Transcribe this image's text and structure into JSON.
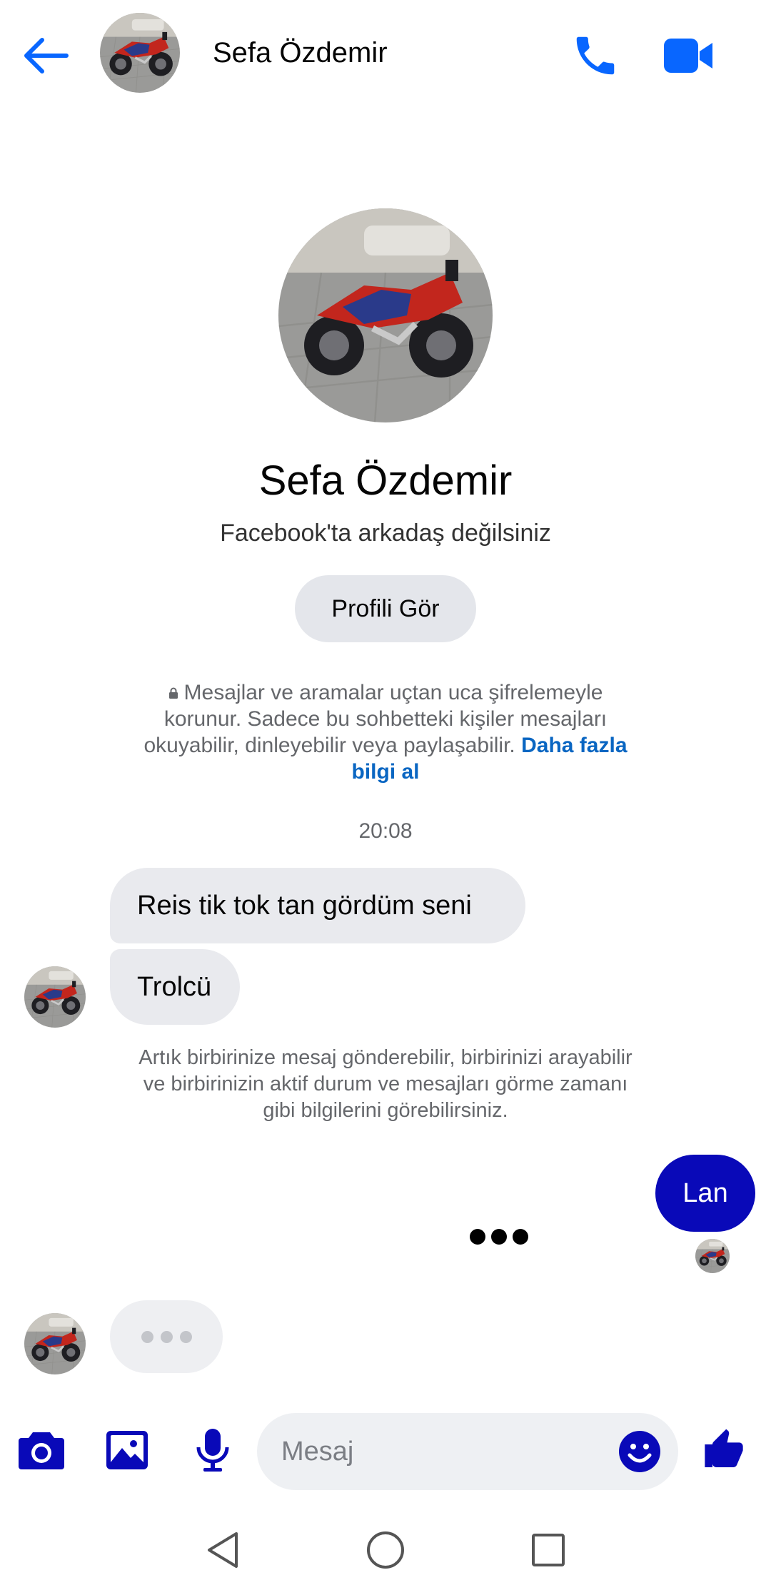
{
  "header": {
    "contact_name": "Sefa Özdemir",
    "back_icon": "arrow-left-icon",
    "call_icon": "phone-icon",
    "video_icon": "video-camera-icon",
    "accent_color": "#0866ff"
  },
  "profile": {
    "name": "Sefa Özdemir",
    "relationship": "Facebook'ta arkadaş değilsiniz",
    "view_profile_label": "Profili Gör"
  },
  "encryption_note": {
    "text": "Mesajlar ve aramalar uçtan uca şifrelemeyle korunur. Sadece bu sohbetteki kişiler mesajları okuyabilir, dinleyebilir veya paylaşabilir.",
    "link": "Daha fazla bilgi al"
  },
  "thread": {
    "timestamp": "20:08",
    "incoming": [
      "Reis tik tok tan gördüm seni",
      "Trolcü"
    ],
    "connection_note": "Artık birbirinize mesaj gönderebilir, birbirinizi arayabilir ve birbirinizin aktif durum ve mesajları görme zamanı gibi bilgilerini görebilirsiniz.",
    "outgoing": [
      "Lan"
    ],
    "outgoing_color": "#0909b8"
  },
  "composer": {
    "placeholder": "Mesaj",
    "camera_icon": "camera-icon",
    "gallery_icon": "image-icon",
    "mic_icon": "microphone-icon",
    "emoji_icon": "smiley-icon",
    "like_icon": "thumbs-up-icon",
    "icon_color": "#0909b8"
  },
  "system_nav": {
    "back_icon": "triangle-back-icon",
    "home_icon": "circle-home-icon",
    "recents_icon": "square-recents-icon"
  }
}
